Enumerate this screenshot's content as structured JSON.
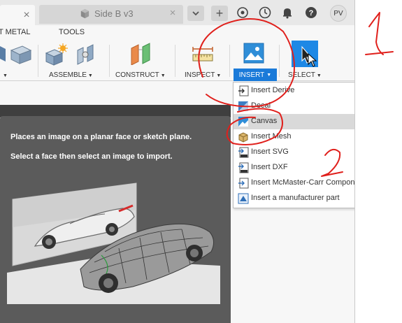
{
  "tabs": {
    "document_title": "Side B v3",
    "close_glyph": "×",
    "new_tab_glyph": "+",
    "more_glyph": "⌄"
  },
  "user": {
    "initials": "PV"
  },
  "ribbon": {
    "tabs": [
      "T METAL",
      "TOOLS"
    ],
    "groups": {
      "assemble": "ASSEMBLE",
      "construct": "CONSTRUCT",
      "inspect": "INSPECT",
      "insert": "INSERT",
      "select": "SELECT"
    }
  },
  "insert_menu": {
    "items": [
      {
        "label": "Insert Derive",
        "icon": "derive-icon"
      },
      {
        "label": "Decal",
        "icon": "decal-icon"
      },
      {
        "label": "Canvas",
        "icon": "canvas-icon",
        "highlighted": true
      },
      {
        "label": "Insert Mesh",
        "icon": "mesh-icon"
      },
      {
        "label": "Insert SVG",
        "icon": "svg-icon"
      },
      {
        "label": "Insert DXF",
        "icon": "dxf-icon"
      },
      {
        "label": "Insert McMaster-Carr Component",
        "icon": "mcmaster-icon"
      },
      {
        "label": "Insert a manufacturer part",
        "icon": "manufacturer-icon"
      }
    ],
    "more_glyph": "⋮"
  },
  "tooltip": {
    "line1": "Places an image on a planar face or sketch plane.",
    "line2": "Select a face then select an image to import."
  },
  "annotations": {
    "color": "#e0201c"
  },
  "colors": {
    "accent": "#1a7ad9",
    "tooltip_bg": "#5b5b5b"
  }
}
